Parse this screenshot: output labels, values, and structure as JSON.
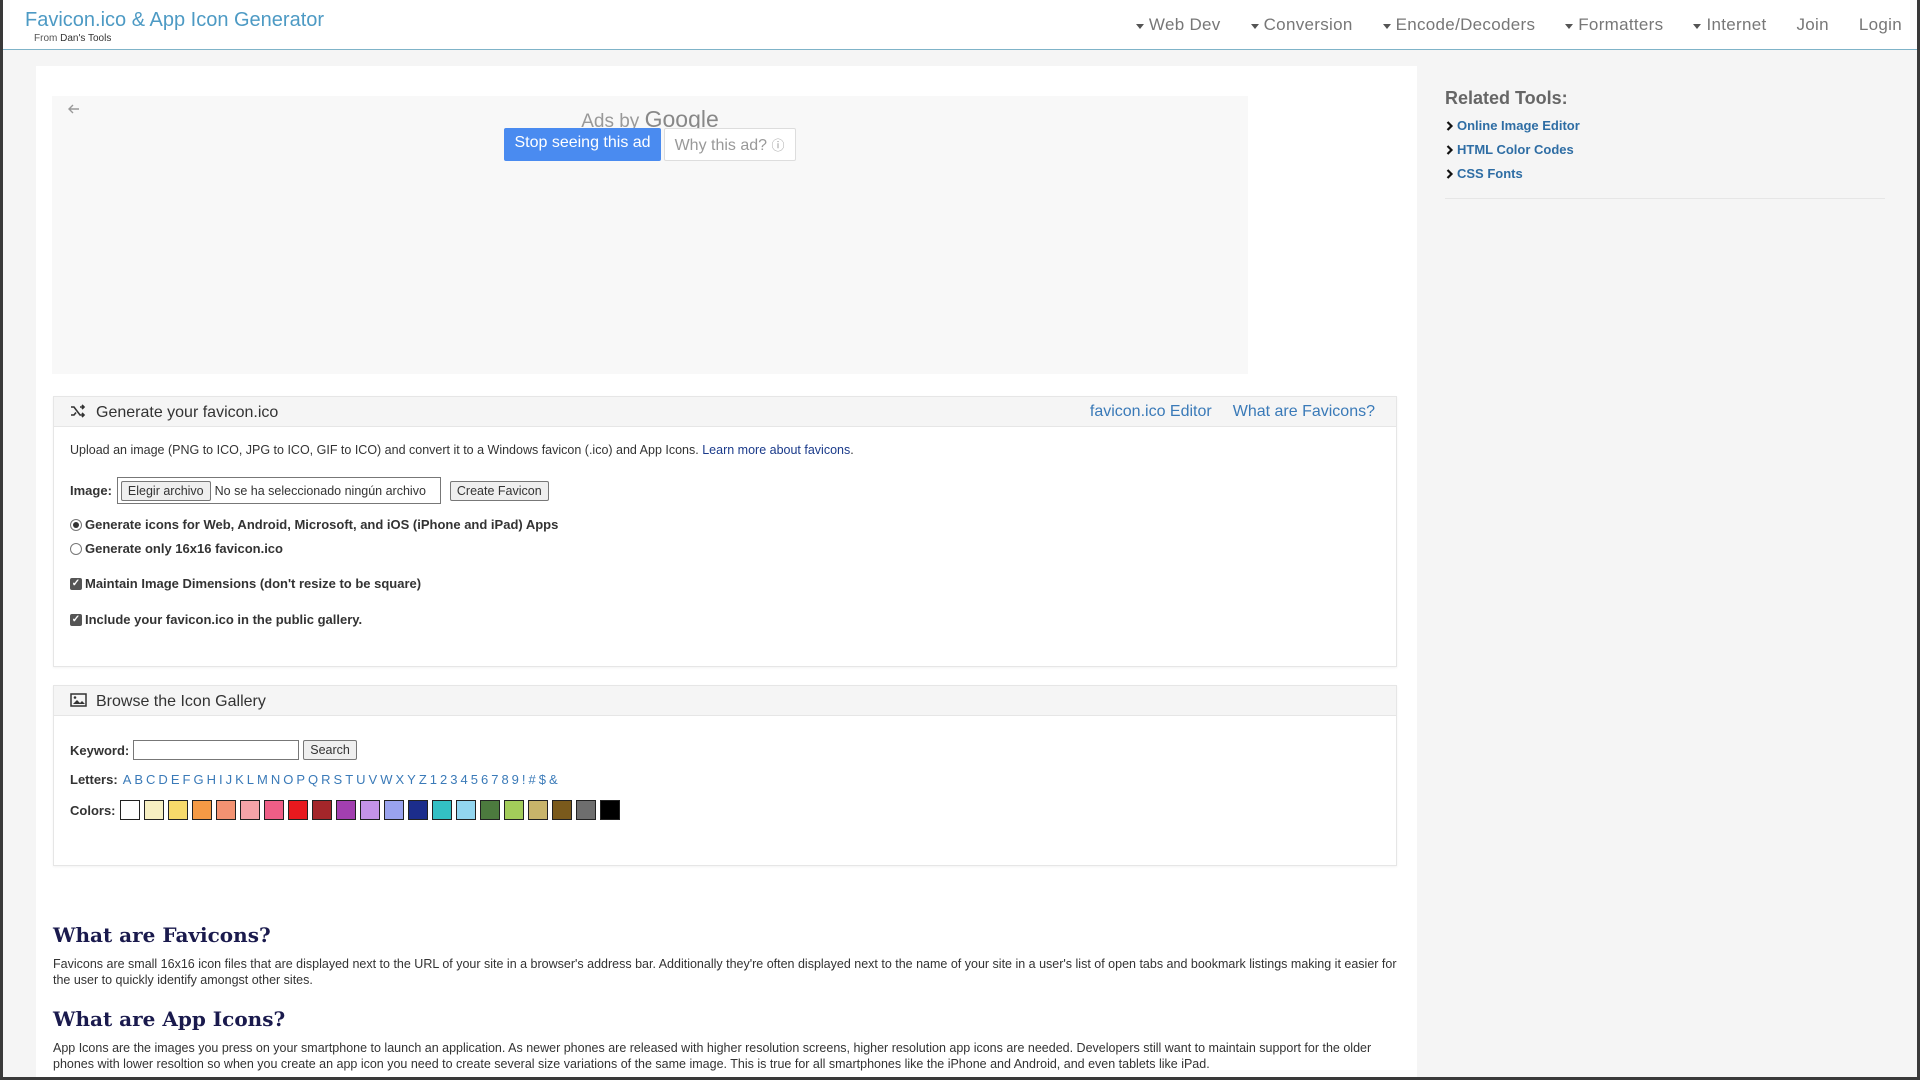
{
  "brand": {
    "title": "Favicon.ico & App Icon Generator",
    "from": "From",
    "sub": "Dan's Tools"
  },
  "nav": {
    "items": [
      {
        "label": "Web Dev",
        "caret": true
      },
      {
        "label": "Conversion",
        "caret": true
      },
      {
        "label": "Encode/Decoders",
        "caret": true
      },
      {
        "label": "Formatters",
        "caret": true
      },
      {
        "label": "Internet",
        "caret": true
      },
      {
        "label": "Join",
        "caret": false
      },
      {
        "label": "Login",
        "caret": false
      }
    ]
  },
  "ad": {
    "ads_by": "Ads by",
    "google": "Google",
    "stop_label": "Stop seeing this ad",
    "why_label": "Why this ad?",
    "back_icon": "arrow-left-icon",
    "info_icon": "info-icon"
  },
  "generate": {
    "title": "Generate your favicon.ico",
    "link_editor": "favicon.ico Editor",
    "link_what": "What are Favicons?",
    "intro": "Upload an image (PNG to ICO, JPG to ICO, GIF to ICO) and convert it to a Windows favicon (.ico) and App Icons.",
    "intro_link": "Learn more about favicons",
    "image_label": "Image:",
    "file_button": "Elegir archivo",
    "file_status": "No se ha seleccionado ningún archivo",
    "create_button": "Create Favicon",
    "radio_all": "Generate icons for Web, Android, Microsoft, and iOS (iPhone and iPad) Apps",
    "radio_only": "Generate only 16x16 favicon.ico",
    "check_dimensions": "Maintain Image Dimensions (don't resize to be square)",
    "check_gallery": "Include your favicon.ico in the public gallery."
  },
  "gallery": {
    "title": "Browse the Icon Gallery",
    "keyword_label": "Keyword:",
    "keyword_value": "",
    "search_button": "Search",
    "letters_label": "Letters:",
    "letters": [
      "A",
      "B",
      "C",
      "D",
      "E",
      "F",
      "G",
      "H",
      "I",
      "J",
      "K",
      "L",
      "M",
      "N",
      "O",
      "P",
      "Q",
      "R",
      "S",
      "T",
      "U",
      "V",
      "W",
      "X",
      "Y",
      "Z",
      "1",
      "2",
      "3",
      "4",
      "5",
      "6",
      "7",
      "8",
      "9",
      "!",
      "#",
      "$",
      "&"
    ],
    "colors_label": "Colors:",
    "colors": [
      "#ffffff",
      "#f7efc2",
      "#f7d96a",
      "#f59a45",
      "#f29272",
      "#f5a3a8",
      "#ee5e86",
      "#e8191e",
      "#a4262a",
      "#a23fb0",
      "#c693e8",
      "#9aa3ee",
      "#1c2d8c",
      "#33c0c4",
      "#92d6f0",
      "#4c7a3e",
      "#a3cc5a",
      "#c8b46a",
      "#7a5a1c",
      "#6e6e6e",
      "#000000"
    ]
  },
  "content": {
    "h_favicons": "What are Favicons?",
    "p_favicons": "Favicons are small 16x16 icon files that are displayed next to the URL of your site in a browser's address bar. Additionally they're often displayed next to the name of your site in a user's list of open tabs and bookmark listings making it easier for the user to quickly identify amongst other sites.",
    "h_appicons": "What are App Icons?",
    "p_appicons": "App Icons are the images you press on your smartphone to launch an application. As newer phones are released with higher resolution screens, higher resolution app icons are needed. Developers still want to maintain support for the older phones with lower resoltion so when you create an app icon you need to create several size variations of the same image. This is true for all smartphones like the iPhone and Android, and even tablets like iPad."
  },
  "sidebar": {
    "title": "Related Tools:",
    "items": [
      {
        "label": "Online Image Editor"
      },
      {
        "label": "HTML Color Codes"
      },
      {
        "label": "CSS Fonts"
      }
    ]
  }
}
